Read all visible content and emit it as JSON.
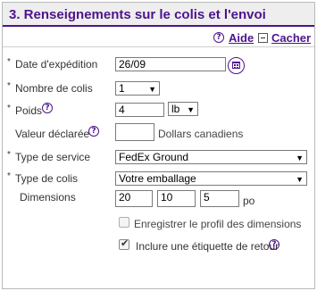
{
  "header": {
    "title": "3. Renseignements sur le colis et l'envoi"
  },
  "help": {
    "aide_label": "Aide",
    "cacher_label": "Cacher"
  },
  "form": {
    "required_mark": "*",
    "ship_date": {
      "label": "Date d'expédition",
      "value": "26/09"
    },
    "num_packages": {
      "label": "Nombre de colis",
      "value": "1"
    },
    "weight": {
      "label": "Poids",
      "value": "4",
      "unit": "lb"
    },
    "declared_value": {
      "label": "Valeur déclarée",
      "value": "",
      "currency": "Dollars canadiens"
    },
    "service_type": {
      "label": "Type de service",
      "value": "FedEx Ground"
    },
    "package_type": {
      "label": "Type de colis",
      "value": "Votre emballage"
    },
    "dimensions": {
      "label": "Dimensions",
      "length": "20",
      "width": "10",
      "height": "5",
      "unit": "po"
    },
    "save_dims": {
      "label": "Enregistrer le profil des dimensions",
      "checked": false
    },
    "return_label": {
      "label": "Inclure une étiquette de retour",
      "checked": true
    }
  },
  "icons": {
    "help": "question-circle-icon",
    "collapse": "minus-box-icon",
    "calendar": "calendar-icon"
  },
  "colors": {
    "brand": "#4d148c",
    "header_bg": "#eeeeee"
  }
}
